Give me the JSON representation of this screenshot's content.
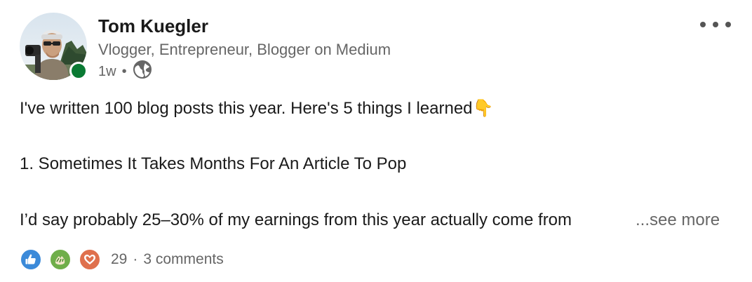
{
  "post": {
    "author": {
      "name": "Tom Kuegler",
      "headline": "Vlogger, Entrepreneur, Blogger on Medium",
      "time_ago": "1w",
      "separator": "•",
      "visibility_icon": "globe-icon",
      "online_status_color": "#0a7a33"
    },
    "menu_icon": "more-horizontal-icon",
    "body": {
      "line1": "I've written 100 blog posts this year. Here's 5 things I learned",
      "line1_emoji": "👇",
      "line2": "1. Sometimes It Takes Months For An Article To Pop",
      "line3": "I’d say probably 25–30% of my earnings from this year actually come from",
      "see_more": "...see more"
    },
    "social": {
      "reaction_icons": [
        "like-icon",
        "celebrate-icon",
        "love-icon"
      ],
      "reaction_count": "29",
      "separator": "·",
      "comments": "3 comments"
    }
  }
}
